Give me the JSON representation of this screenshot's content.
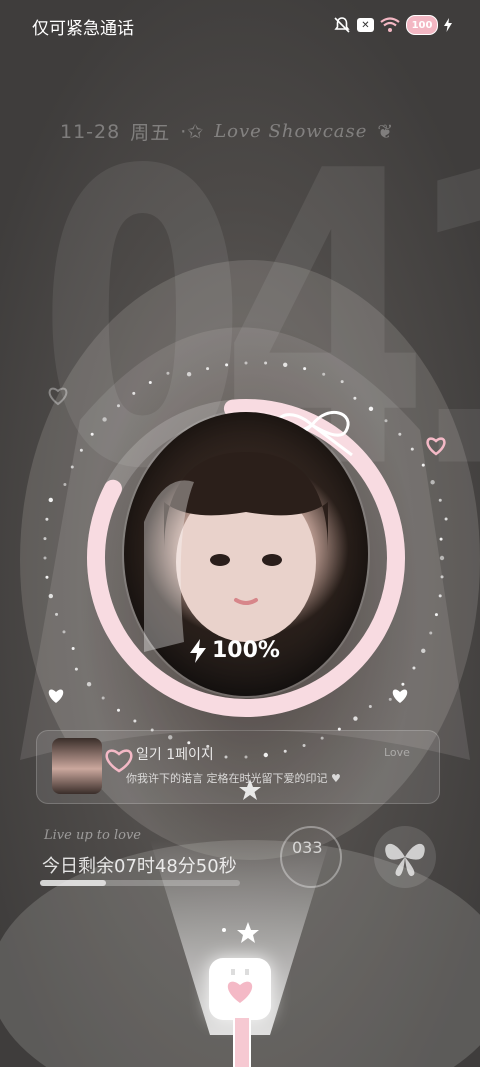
{
  "status_bar": {
    "emergency_text": "仅可紧急通话",
    "battery_badge": "100"
  },
  "widget": {
    "date": "11-28",
    "weekday": "周五",
    "script_title": "Love Showcase",
    "clock": "0411",
    "charge_percent": "100%",
    "charge_level": 100
  },
  "diary": {
    "title": "일기 1페이지",
    "subtitle": "你我许下的诺言 定格在时光留下爱的印记 ♥",
    "tag": "Love"
  },
  "countdown": {
    "script": "Live up to love",
    "text": "今日剩余07时48分50秒",
    "progress": 0.33,
    "count": "033"
  },
  "colors": {
    "ring": "#f8dbe1",
    "accent_pink": "#f4b9c6",
    "background": "#4a4847"
  },
  "icons": [
    "mute-icon",
    "no-sim-icon",
    "wifi-icon",
    "battery-icon",
    "bolt-icon",
    "ribbon-bow-icon",
    "heart-icon",
    "star-icon",
    "butterfly-icon",
    "charger-plug-icon"
  ]
}
